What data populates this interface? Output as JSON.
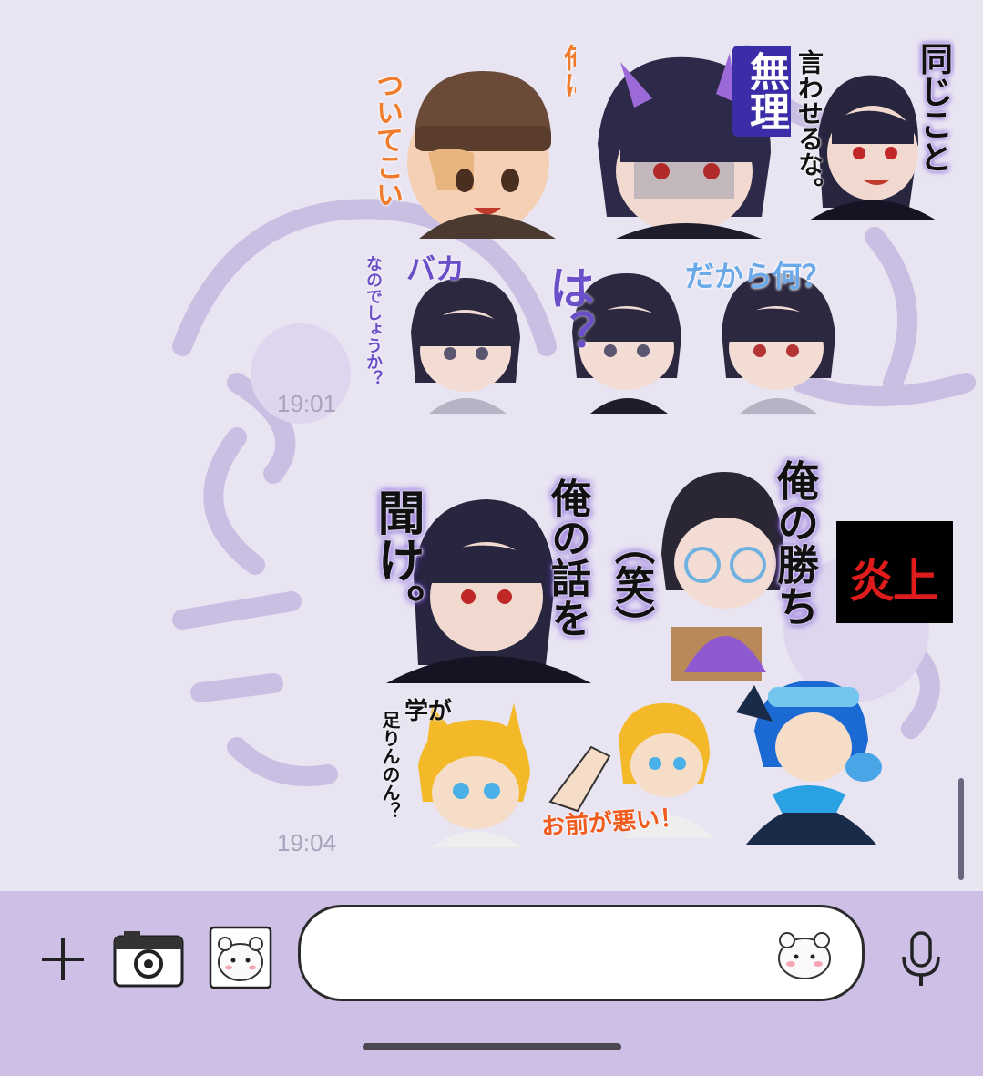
{
  "messages": [
    {
      "time": "19:01"
    },
    {
      "time": "19:04"
    }
  ],
  "stickers": {
    "s1": [
      "俺に",
      "ついてこい"
    ],
    "s2": [
      "無理"
    ],
    "s3": [
      "同じこと",
      "言わせるな。"
    ],
    "s4": [
      "バカ",
      "なのでしょうか？"
    ],
    "s5": [
      "は？"
    ],
    "s6": [
      "だから何？"
    ],
    "s7": [
      "聞け。",
      "俺の話を"
    ],
    "s8": [
      "（笑）",
      "俺の勝ち"
    ],
    "s9": [
      "炎上"
    ],
    "s10": [
      "学が",
      "足りんのん？"
    ],
    "s11": [
      "お前が悪い！"
    ]
  },
  "input_bar": {
    "message_value": ""
  },
  "icons": {
    "add": "plus-icon",
    "camera": "camera-icon",
    "sticker": "hamster-sticker-icon",
    "emoji": "hamster-emoji-icon",
    "mic": "microphone-icon"
  },
  "colors": {
    "chat_bg": "#e8e4f2",
    "bar_bg": "#cdbfe6",
    "accent_purple": "#6b3fd1",
    "flame_red": "#e01b1b"
  }
}
